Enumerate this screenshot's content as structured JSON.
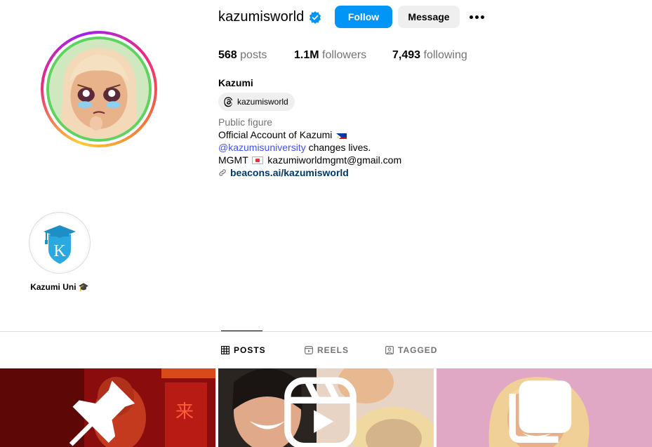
{
  "profile": {
    "username": "kazumisworld",
    "follow_label": "Follow",
    "message_label": "Message",
    "stats": {
      "posts_count": "568",
      "posts_label": "posts",
      "followers_count": "1.1M",
      "followers_label": "followers",
      "following_count": "7,493",
      "following_label": "following"
    },
    "full_name": "Kazumi",
    "threads_handle": "kazumisworld",
    "category": "Public figure",
    "bio_line1": "Official Account of Kazumi",
    "bio_mention": "@kazumisuniversity",
    "bio_line2_rest": " changes lives.",
    "bio_mgmt_prefix": "MGMT",
    "bio_email": "kazumiworldmgmt@gmail.com",
    "link": "beacons.ai/kazumisworld"
  },
  "highlights": [
    {
      "label": "Kazumi Uni 🎓"
    }
  ],
  "tabs": [
    {
      "label": "POSTS",
      "icon": "grid-icon",
      "active": true
    },
    {
      "label": "REELS",
      "icon": "reels-icon",
      "active": false
    },
    {
      "label": "TAGGED",
      "icon": "tagged-icon",
      "active": false
    }
  ],
  "posts": [
    {
      "badge": "pin-icon"
    },
    {
      "badge": "reels-icon"
    },
    {
      "badge": "carousel-icon"
    }
  ],
  "colors": {
    "follow_button": "#0095f6",
    "link": "#00376b",
    "mention": "#4150f7",
    "verified": "#0095f6"
  }
}
